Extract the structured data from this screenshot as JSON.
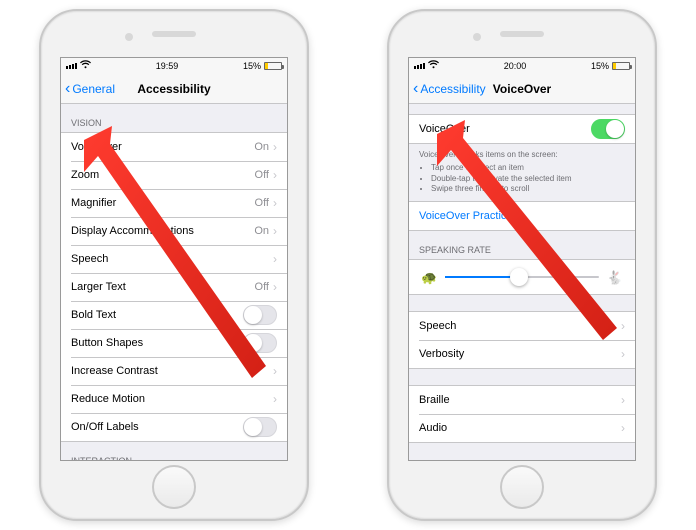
{
  "phone1": {
    "status": {
      "time": "19:59",
      "battery": "15%"
    },
    "nav": {
      "back": "General",
      "title": "Accessibility"
    },
    "section_vision": "Vision",
    "rows": {
      "voiceover": {
        "label": "VoiceOver",
        "value": "On"
      },
      "zoom": {
        "label": "Zoom",
        "value": "Off"
      },
      "magnifier": {
        "label": "Magnifier",
        "value": "Off"
      },
      "display": {
        "label": "Display Accommodations",
        "value": "On"
      },
      "speech": {
        "label": "Speech"
      },
      "larger": {
        "label": "Larger Text",
        "value": "Off"
      },
      "bold": {
        "label": "Bold Text"
      },
      "shapes": {
        "label": "Button Shapes"
      },
      "contrast": {
        "label": "Increase Contrast"
      },
      "motion": {
        "label": "Reduce Motion"
      },
      "labels": {
        "label": "On/Off Labels"
      }
    },
    "section_interaction": "Interaction"
  },
  "phone2": {
    "status": {
      "time": "20:00",
      "battery": "15%"
    },
    "nav": {
      "back": "Accessibility",
      "title": "VoiceOver"
    },
    "voiceover_row": "VoiceOver",
    "help": {
      "intro": "VoiceOver speaks items on the screen:",
      "b1": "Tap once to select an item",
      "b2": "Double-tap to activate the selected item",
      "b3": "Swipe three fingers to scroll"
    },
    "practice": "VoiceOver Practice",
    "section_rate": "Speaking Rate",
    "rows2": {
      "speech": {
        "label": "Speech"
      },
      "verbosity": {
        "label": "Verbosity"
      },
      "braille": {
        "label": "Braille"
      },
      "audio": {
        "label": "Audio"
      }
    }
  }
}
